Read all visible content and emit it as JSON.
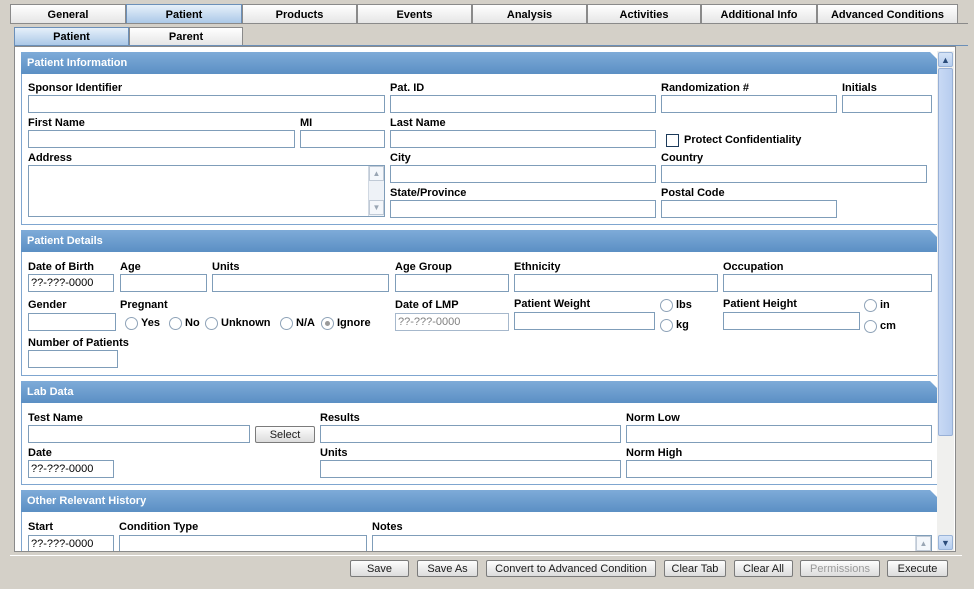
{
  "tabs": [
    "General",
    "Patient",
    "Products",
    "Events",
    "Analysis",
    "Activities",
    "Additional Info",
    "Advanced Conditions"
  ],
  "subtabs": [
    "Patient",
    "Parent"
  ],
  "patient_info": {
    "title": "Patient Information",
    "sponsor_identifier": "Sponsor Identifier",
    "pat_id": "Pat. ID",
    "randomization": "Randomization #",
    "initials": "Initials",
    "first_name": "First Name",
    "mi": "MI",
    "last_name": "Last Name",
    "protect_confidentiality": "Protect Confidentiality",
    "address": "Address",
    "city": "City",
    "country": "Country",
    "state_province": "State/Province",
    "postal_code": "Postal Code"
  },
  "patient_details": {
    "title": "Patient Details",
    "date_of_birth": "Date of Birth",
    "date_of_birth_value": "??-???-0000",
    "age": "Age",
    "units": "Units",
    "age_group": "Age Group",
    "ethnicity": "Ethnicity",
    "occupation": "Occupation",
    "gender": "Gender",
    "pregnant": "Pregnant",
    "pregnant_options": [
      "Yes",
      "No",
      "Unknown",
      "N/A",
      "Ignore"
    ],
    "date_of_lmp": "Date of LMP",
    "date_of_lmp_value": "??-???-0000",
    "patient_weight": "Patient Weight",
    "weight_units": [
      "lbs",
      "kg"
    ],
    "patient_height": "Patient Height",
    "height_units": [
      "in",
      "cm"
    ],
    "number_of_patients": "Number of Patients"
  },
  "lab_data": {
    "title": "Lab Data",
    "test_name": "Test Name",
    "select_label": "Select",
    "results": "Results",
    "norm_low": "Norm Low",
    "date": "Date",
    "date_value": "??-???-0000",
    "units": "Units",
    "norm_high": "Norm High"
  },
  "history": {
    "title": "Other Relevant History",
    "start": "Start",
    "start_value": "??-???-0000",
    "condition_type": "Condition Type",
    "notes": "Notes"
  },
  "footer_buttons": {
    "save": "Save",
    "save_as": "Save As",
    "convert": "Convert to Advanced Condition",
    "clear_tab": "Clear Tab",
    "clear_all": "Clear All",
    "permissions": "Permissions",
    "execute": "Execute"
  }
}
